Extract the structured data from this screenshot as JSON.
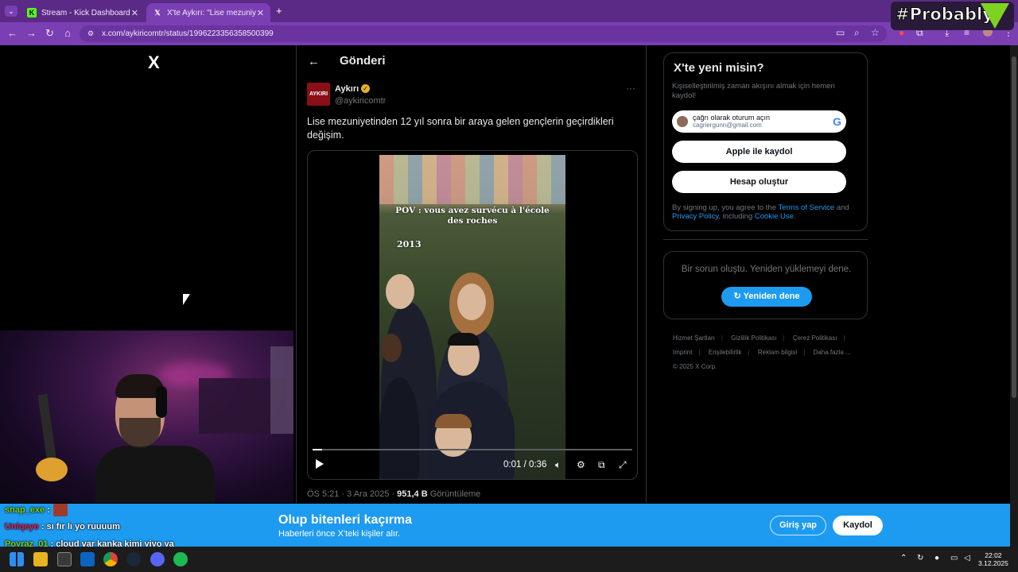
{
  "browser": {
    "tabs": [
      {
        "label": "Stream - Kick Dashboard",
        "active": false
      },
      {
        "label": "X'te Aykırı: \"Lise mezuniyetinde",
        "active": true
      }
    ],
    "url": "x.com/aykiricomtr/status/1996223356358500399"
  },
  "overlay": {
    "brand_text": "#Probably"
  },
  "sidebar": {
    "logo": "X"
  },
  "post": {
    "header_title": "Gönderi",
    "author_name": "Aykırı",
    "author_handle": "@aykiricomtr",
    "avatar_text": "AYKIRI",
    "text": "Lise mezuniyetinden 12 yıl sonra bir araya gelen gençlerin geçirdikleri değişim.",
    "video": {
      "overlay_text": "POV : vous avez survécu à l'école des roches",
      "year_text": "2013",
      "time": "0:01 / 0:36",
      "progress": 0.03
    },
    "meta_time": "ÖS 5:21 · 3 Ara 2025 · ",
    "views_count": "951,4 B",
    "views_label": " Görüntüleme"
  },
  "signup": {
    "title": "X'te yeni misin?",
    "subtitle": "Kişiselleştirilmiş zaman akışını almak için hemen kaydol!",
    "google_line1": "çağrı olarak oturum açın",
    "google_line2": "cagriergunn@gmail.com",
    "apple_label": "Apple ile kaydol",
    "create_label": "Hesap oluştur",
    "terms_prefix": "By signing up, you agree to the ",
    "terms_link": "Terms of Service",
    "terms_and": " and ",
    "privacy_link": "Privacy Policy",
    "terms_including": ", including ",
    "cookie_link": "Cookie Use",
    "terms_end": "."
  },
  "error_box": {
    "message": "Bir sorun oluştu. Yeniden yüklemeyi dene.",
    "retry_label": "Yeniden dene"
  },
  "footer": {
    "links": [
      "Hizmet Şartları",
      "Gizlilik Politikası",
      "Çerez Politikası",
      "Imprint",
      "Erişilebilirlik",
      "Reklam bilgisi",
      "Daha fazla ..."
    ],
    "copyright": "© 2025 X Corp."
  },
  "banner": {
    "title": "Olup bitenleri kaçırma",
    "subtitle": "Haberleri önce X'teki kişiler alır.",
    "login_label": "Giriş yap",
    "register_label": "Kaydol"
  },
  "chat": [
    {
      "user": "snap_exe",
      "color": "#7ed321",
      "message": " :"
    },
    {
      "user": "Uniqeye",
      "color": "#e0245e",
      "message": " : sı fır lı yo ruuuum"
    },
    {
      "user": "Poyraz_01",
      "color": "#7ed321",
      "message": " : cloud var kanka kimi yiyo ya"
    }
  ],
  "taskbar": {
    "time": "22:02",
    "date": "3.12.2025"
  },
  "colors": {
    "x_blue": "#1d9bf0",
    "browser_purple": "#7a3fb3",
    "verified_gold": "#e8b321"
  }
}
